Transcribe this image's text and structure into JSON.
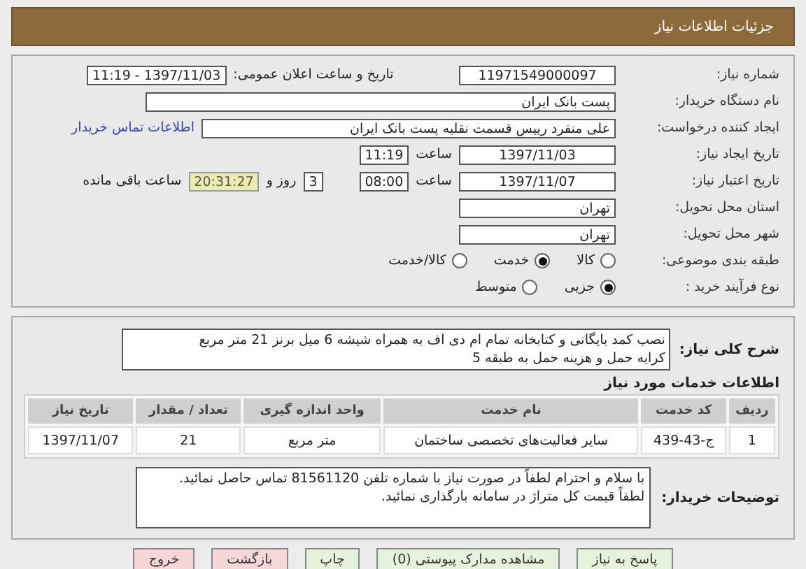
{
  "header": {
    "title": "جزئیات اطلاعات نیاز"
  },
  "need_number": {
    "label": "شماره نیاز:",
    "value": "11971549000097"
  },
  "announce": {
    "label": "تاریخ و ساعت اعلان عمومی:",
    "value": "1397/11/03 - 11:19"
  },
  "buyer_org": {
    "label": "نام دستگاه خریدار:",
    "value": "پست بانک ایران"
  },
  "requester": {
    "label": "ایجاد کننده درخواست:",
    "value": "علی منفرد رییس قسمت نقلیه پست بانک ایران",
    "link": "اطلاعات تماس خریدار"
  },
  "created": {
    "label": "تاریخ ایجاد نیاز:",
    "date": "1397/11/03",
    "time_label": "ساعت",
    "time": "11:19"
  },
  "validity": {
    "label": "تاریخ اعتبار نیاز:",
    "date": "1397/11/07",
    "time_label": "ساعت",
    "time": "08:00",
    "days": "3",
    "days_label": "روز و",
    "remaining": "20:31:27",
    "remaining_label": "ساعت باقی مانده"
  },
  "province": {
    "label": "استان محل تحویل:",
    "value": "تهران"
  },
  "city": {
    "label": "شهر محل تحویل:",
    "value": "تهران"
  },
  "category": {
    "label": "طبقه بندی موضوعی:",
    "options": [
      {
        "label": "کالا",
        "selected": false
      },
      {
        "label": "خدمت",
        "selected": true
      },
      {
        "label": "کالا/خدمت",
        "selected": false
      }
    ]
  },
  "process": {
    "label": "نوع فرآیند خرید :",
    "options": [
      {
        "label": "جزیی",
        "selected": true
      },
      {
        "label": "متوسط",
        "selected": false
      }
    ]
  },
  "description": {
    "label": "شرح کلی نیاز:",
    "lines": [
      "نصب کمد بایگانی و کتابخانه تمام ام دی اف به همراه شیشه 6 میل برنز 21 متر مربع",
      "کرایه حمل و هزینه حمل به طبقه 5"
    ]
  },
  "services": {
    "title": "اطلاعات خدمات مورد نیاز",
    "columns": [
      "ردیف",
      "کد خدمت",
      "نام خدمت",
      "واحد اندازه گیری",
      "تعداد / مقدار",
      "تاریخ نیاز"
    ],
    "rows": [
      [
        "1",
        "ج-43-439",
        "سایر فعالیت‌های تخصصی ساختمان",
        "متر مربع",
        "21",
        "1397/11/07"
      ]
    ]
  },
  "buyer_notes": {
    "label": "توضیحات خریدار:",
    "lines": [
      "با سلام و احترام لطفاً در صورت نیاز با شماره تلفن 81561120 تماس حاصل نمائید.",
      "لطفاً قیمت کل متراژ در سامانه بارگذاری نمائید."
    ]
  },
  "buttons": [
    {
      "label": "پاسخ به نیاز",
      "color": "#e6f3dc"
    },
    {
      "label": "مشاهده مدارک پیوستی (0)",
      "color": "#e6f3dc"
    },
    {
      "label": "چاپ",
      "color": "#e6f3dc"
    },
    {
      "label": "بازگشت",
      "color": "#f6d6d6"
    },
    {
      "label": "خروج",
      "color": "#f6d6d6"
    }
  ]
}
